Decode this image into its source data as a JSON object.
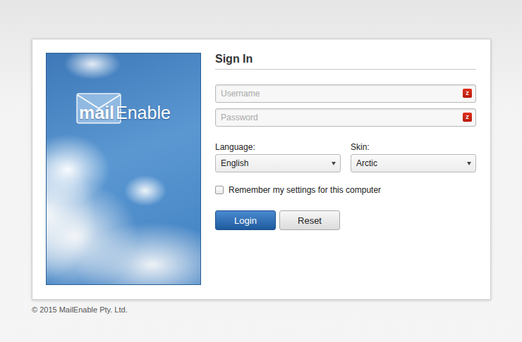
{
  "brand": {
    "logo_bold": "mail",
    "logo_light": "Enable"
  },
  "title": "Sign In",
  "fields": [
    {
      "placeholder": "Username",
      "badge": "z",
      "kind": "text"
    },
    {
      "placeholder": "Password",
      "badge": "z",
      "kind": "password"
    }
  ],
  "selects": [
    {
      "label": "Language:",
      "value": "English"
    },
    {
      "label": "Skin:",
      "value": "Arctic"
    }
  ],
  "remember": {
    "label": "Remember my settings for this computer",
    "checked": false
  },
  "buttons": [
    {
      "label": "Login",
      "kind": "primary"
    },
    {
      "label": "Reset",
      "kind": "secondary"
    }
  ],
  "footer": "© 2015 MailEnable Pty. Ltd."
}
